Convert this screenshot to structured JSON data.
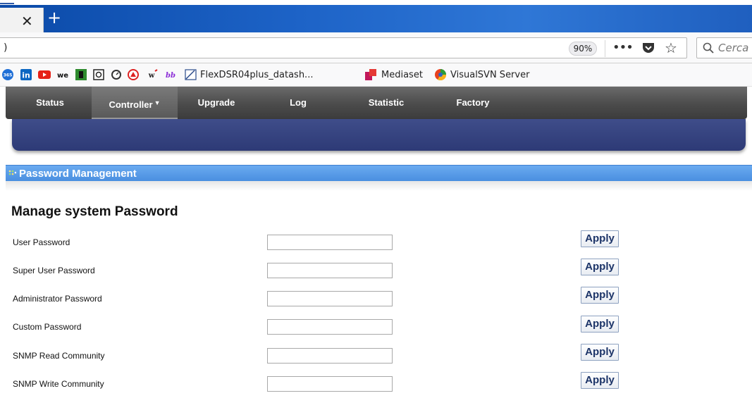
{
  "browser": {
    "tab_close_icon": "close-icon",
    "new_tab_icon": "plus-icon",
    "url_text": ")",
    "zoom_level": "90%",
    "search_placeholder": "Cerca"
  },
  "bookmarks": [
    {
      "icon": "office365-icon",
      "label": ""
    },
    {
      "icon": "linkedin-icon",
      "label": ""
    },
    {
      "icon": "youtube-icon",
      "label": ""
    },
    {
      "icon": "wetransfer-icon",
      "label": ""
    },
    {
      "icon": "green-bookmark-icon",
      "label": ""
    },
    {
      "icon": "image-bookmark-icon",
      "label": ""
    },
    {
      "icon": "gauge-icon",
      "label": ""
    },
    {
      "icon": "red-circle-icon",
      "label": ""
    },
    {
      "icon": "wordreference-icon",
      "label": ""
    },
    {
      "icon": "dictionary-icon",
      "label": ""
    },
    {
      "icon": "flexdsr-icon",
      "label": "FlexDSR04plus_datash..."
    },
    {
      "icon": "mediaset-icon",
      "label": "Mediaset"
    },
    {
      "icon": "visualsvn-icon",
      "label": "VisualSVN Server"
    }
  ],
  "nav": {
    "items": [
      {
        "label": "Status",
        "active": false
      },
      {
        "label": "Controller",
        "active": true
      },
      {
        "label": "Upgrade",
        "active": false
      },
      {
        "label": "Log",
        "active": false
      },
      {
        "label": "Statistic",
        "active": false
      },
      {
        "label": "Factory",
        "active": false
      }
    ]
  },
  "section": {
    "title": "Password Management"
  },
  "form": {
    "title": "Manage system Password",
    "rows": [
      {
        "label": "User Password",
        "value": "",
        "button": "Apply"
      },
      {
        "label": "Super User Password",
        "value": "",
        "button": "Apply"
      },
      {
        "label": "Administrator Password",
        "value": "",
        "button": "Apply"
      },
      {
        "label": "Custom Password",
        "value": "",
        "button": "Apply"
      },
      {
        "label": "SNMP Read Community",
        "value": "",
        "button": "Apply"
      },
      {
        "label": "SNMP Write Community",
        "value": "",
        "button": "Apply"
      }
    ]
  },
  "colors": {
    "tab_strip": "#1d63c7",
    "nav_bar": "#4b4b4b",
    "banner": "#2d3a76",
    "section_header": "#4a8fe0",
    "apply_text": "#1c3468"
  }
}
